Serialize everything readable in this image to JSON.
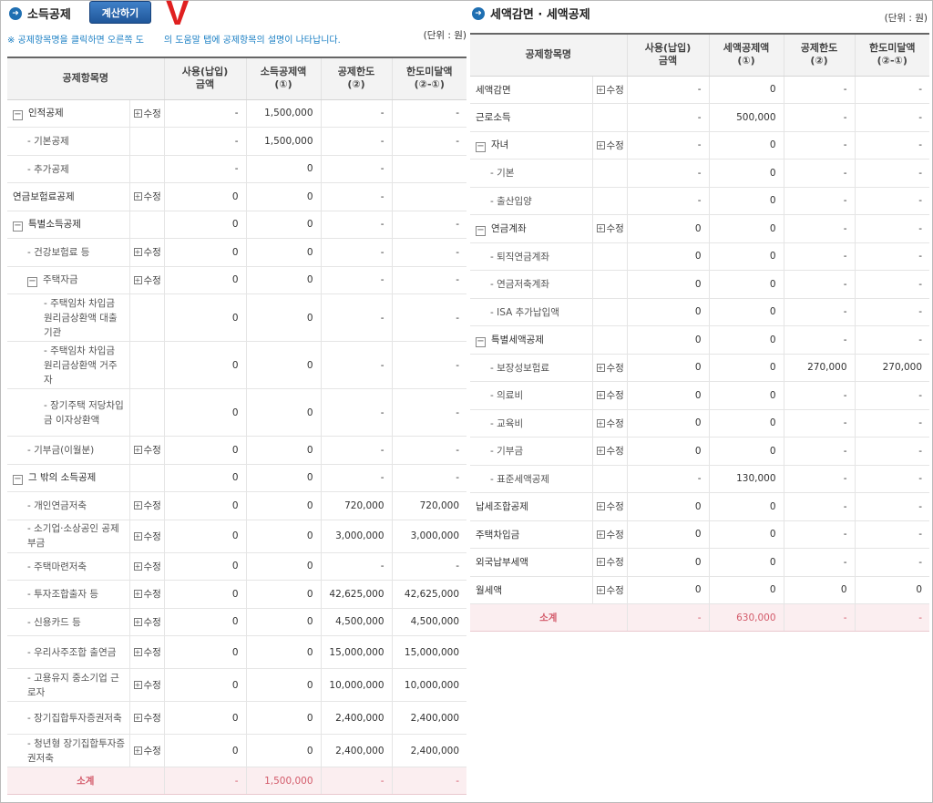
{
  "left": {
    "title": "소득공제",
    "calc_button": "계산하기",
    "v_mark": "V",
    "help_text": "※ 공제항목명을 클릭하면 오른쪽 도",
    "help_text_end": "의 도움말 탭에 공제항목의 설명이 나타납니다.",
    "unit": "(단위 : 원)",
    "headers": [
      "공제항목명",
      "사용(납입)\n금액",
      "소득공제액\n(①)",
      "공제한도\n(②)",
      "한도미달액\n(②-①)"
    ],
    "rows": [
      {
        "name": "인적공제",
        "level": 0,
        "toggle": "−",
        "edit": "수정",
        "c1": "-",
        "c2": "1,500,000",
        "c3": "-",
        "c4": "-"
      },
      {
        "name": "- 기본공제",
        "level": 1,
        "toggle": "",
        "edit": "",
        "c1": "-",
        "c2": "1,500,000",
        "c3": "-",
        "c4": "-"
      },
      {
        "name": "- 추가공제",
        "level": 1,
        "toggle": "",
        "edit": "",
        "c1": "-",
        "c2": "0",
        "c3": "-",
        "c4": ""
      },
      {
        "name": "연금보험료공제",
        "level": 0,
        "toggle": "",
        "edit": "수정",
        "c1": "0",
        "c2": "0",
        "c3": "-",
        "c4": ""
      },
      {
        "name": "특별소득공제",
        "level": 0,
        "toggle": "−",
        "edit": "",
        "c1": "0",
        "c2": "0",
        "c3": "-",
        "c4": "-"
      },
      {
        "name": "- 건강보험료 등",
        "level": 1,
        "toggle": "",
        "edit": "수정",
        "c1": "0",
        "c2": "0",
        "c3": "-",
        "c4": "-"
      },
      {
        "name": "주택자금",
        "level": 1,
        "toggle": "−",
        "edit": "수정",
        "c1": "0",
        "c2": "0",
        "c3": "-",
        "c4": "-"
      },
      {
        "name": "- 주택임차 차입금 원리금상환액 대출기관",
        "level": 2,
        "toggle": "",
        "edit": "",
        "c1": "0",
        "c2": "0",
        "c3": "-",
        "c4": "-",
        "h": 52
      },
      {
        "name": "- 주택임차 차입금 원리금상환액 거주자",
        "level": 2,
        "toggle": "",
        "edit": "",
        "c1": "0",
        "c2": "0",
        "c3": "-",
        "c4": "-",
        "h": 52
      },
      {
        "name": "- 장기주택 저당차입금 이자상환액",
        "level": 2,
        "toggle": "",
        "edit": "",
        "c1": "0",
        "c2": "0",
        "c3": "-",
        "c4": "-",
        "h": 52
      },
      {
        "name": "- 기부금(이월분)",
        "level": 1,
        "toggle": "",
        "edit": "수정",
        "c1": "0",
        "c2": "0",
        "c3": "-",
        "c4": "-"
      },
      {
        "name": "그 밖의 소득공제",
        "level": 0,
        "toggle": "−",
        "edit": "",
        "c1": "0",
        "c2": "0",
        "c3": "-",
        "c4": "-"
      },
      {
        "name": "- 개인연금저축",
        "level": 1,
        "toggle": "",
        "edit": "수정",
        "c1": "0",
        "c2": "0",
        "c3": "720,000",
        "c4": "720,000"
      },
      {
        "name": "- 소기업·소상공인 공제부금",
        "level": 1,
        "toggle": "",
        "edit": "수정",
        "c1": "0",
        "c2": "0",
        "c3": "3,000,000",
        "c4": "3,000,000",
        "h": 36
      },
      {
        "name": "- 주택마련저축",
        "level": 1,
        "toggle": "",
        "edit": "수정",
        "c1": "0",
        "c2": "0",
        "c3": "-",
        "c4": "-"
      },
      {
        "name": "- 투자조합출자 등",
        "level": 1,
        "toggle": "",
        "edit": "수정",
        "c1": "0",
        "c2": "0",
        "c3": "42,625,000",
        "c4": "42,625,000"
      },
      {
        "name": "- 신용카드 등",
        "level": 1,
        "toggle": "",
        "edit": "수정",
        "c1": "0",
        "c2": "0",
        "c3": "4,500,000",
        "c4": "4,500,000"
      },
      {
        "name": "- 우리사주조합 출연금",
        "level": 1,
        "toggle": "",
        "edit": "수정",
        "c1": "0",
        "c2": "0",
        "c3": "15,000,000",
        "c4": "15,000,000",
        "h": 36
      },
      {
        "name": "- 고용유지 중소기업 근로자",
        "level": 1,
        "toggle": "",
        "edit": "수정",
        "c1": "0",
        "c2": "0",
        "c3": "10,000,000",
        "c4": "10,000,000",
        "h": 36
      },
      {
        "name": "- 장기집합투자증권저축",
        "level": 1,
        "toggle": "",
        "edit": "수정",
        "c1": "0",
        "c2": "0",
        "c3": "2,400,000",
        "c4": "2,400,000",
        "h": 36
      },
      {
        "name": "- 청년형 장기집합투자증권저축",
        "level": 1,
        "toggle": "",
        "edit": "수정",
        "c1": "0",
        "c2": "0",
        "c3": "2,400,000",
        "c4": "2,400,000",
        "h": 36
      }
    ],
    "subtotal": {
      "name": "소계",
      "c1": "-",
      "c2": "1,500,000",
      "c3": "-",
      "c4": "-"
    }
  },
  "right": {
    "title": "세액감면 · 세액공제",
    "unit": "(단위 : 원)",
    "headers": [
      "공제항목명",
      "사용(납입)\n금액",
      "세액공제액\n(①)",
      "공제한도\n(②)",
      "한도미달액\n(②-①)"
    ],
    "rows": [
      {
        "name": "세액감면",
        "level": 0,
        "toggle": "",
        "edit": "수정",
        "c1": "-",
        "c2": "0",
        "c3": "-",
        "c4": "-"
      },
      {
        "name": "근로소득",
        "level": 0,
        "toggle": "",
        "edit": "",
        "c1": "-",
        "c2": "500,000",
        "c3": "-",
        "c4": "-"
      },
      {
        "name": "자녀",
        "level": 0,
        "toggle": "−",
        "edit": "수정",
        "c1": "-",
        "c2": "0",
        "c3": "-",
        "c4": "-"
      },
      {
        "name": "- 기본",
        "level": 1,
        "toggle": "",
        "edit": "",
        "c1": "-",
        "c2": "0",
        "c3": "-",
        "c4": "-"
      },
      {
        "name": "- 출산입양",
        "level": 1,
        "toggle": "",
        "edit": "",
        "c1": "-",
        "c2": "0",
        "c3": "-",
        "c4": "-"
      },
      {
        "name": "연금계좌",
        "level": 0,
        "toggle": "−",
        "edit": "수정",
        "c1": "0",
        "c2": "0",
        "c3": "-",
        "c4": "-"
      },
      {
        "name": "- 퇴직연금계좌",
        "level": 1,
        "toggle": "",
        "edit": "",
        "c1": "0",
        "c2": "0",
        "c3": "-",
        "c4": "-"
      },
      {
        "name": "- 연금저축계좌",
        "level": 1,
        "toggle": "",
        "edit": "",
        "c1": "0",
        "c2": "0",
        "c3": "-",
        "c4": "-"
      },
      {
        "name": "- ISA 추가납입액",
        "level": 1,
        "toggle": "",
        "edit": "",
        "c1": "0",
        "c2": "0",
        "c3": "-",
        "c4": "-"
      },
      {
        "name": "특별세액공제",
        "level": 0,
        "toggle": "−",
        "edit": "",
        "c1": "0",
        "c2": "0",
        "c3": "-",
        "c4": "-"
      },
      {
        "name": "- 보장성보험료",
        "level": 1,
        "toggle": "",
        "edit": "수정",
        "c1": "0",
        "c2": "0",
        "c3": "270,000",
        "c4": "270,000"
      },
      {
        "name": "- 의료비",
        "level": 1,
        "toggle": "",
        "edit": "수정",
        "c1": "0",
        "c2": "0",
        "c3": "-",
        "c4": "-"
      },
      {
        "name": "- 교육비",
        "level": 1,
        "toggle": "",
        "edit": "수정",
        "c1": "0",
        "c2": "0",
        "c3": "-",
        "c4": "-"
      },
      {
        "name": "- 기부금",
        "level": 1,
        "toggle": "",
        "edit": "수정",
        "c1": "0",
        "c2": "0",
        "c3": "-",
        "c4": "-"
      },
      {
        "name": "- 표준세액공제",
        "level": 1,
        "toggle": "",
        "edit": "",
        "c1": "-",
        "c2": "130,000",
        "c3": "-",
        "c4": "-"
      },
      {
        "name": "납세조합공제",
        "level": 0,
        "toggle": "",
        "edit": "수정",
        "c1": "0",
        "c2": "0",
        "c3": "-",
        "c4": "-"
      },
      {
        "name": "주택차입금",
        "level": 0,
        "toggle": "",
        "edit": "수정",
        "c1": "0",
        "c2": "0",
        "c3": "-",
        "c4": "-"
      },
      {
        "name": "외국납부세액",
        "level": 0,
        "toggle": "",
        "edit": "수정",
        "c1": "0",
        "c2": "0",
        "c3": "-",
        "c4": "-"
      },
      {
        "name": "월세액",
        "level": 0,
        "toggle": "",
        "edit": "수정",
        "c1": "0",
        "c2": "0",
        "c3": "0",
        "c4": "0"
      }
    ],
    "subtotal": {
      "name": "소계",
      "c1": "-",
      "c2": "630,000",
      "c3": "-",
      "c4": "-"
    }
  },
  "colors": {
    "accent": "#1f6fb2",
    "subtotal_text": "#d35a6a",
    "subtotal_bg": "#fbeef0",
    "v_mark": "#e02020"
  }
}
